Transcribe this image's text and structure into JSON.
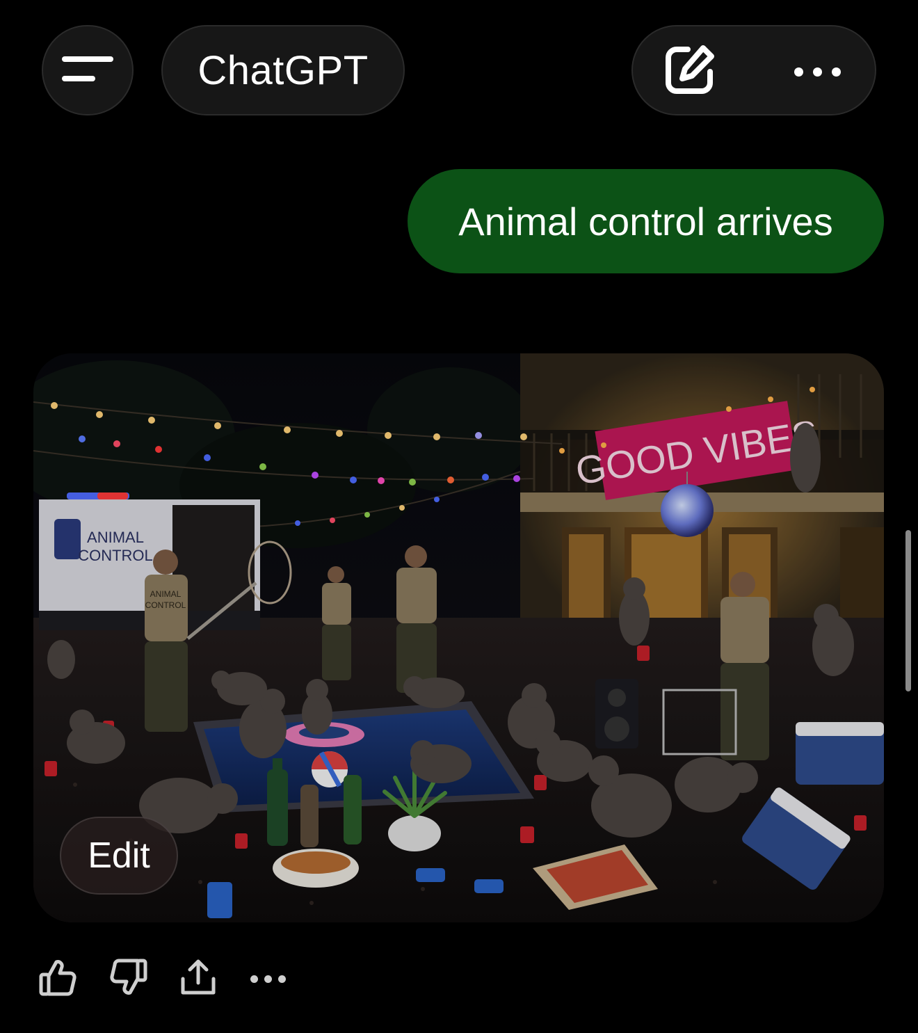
{
  "header": {
    "title": "ChatGPT",
    "menu_icon": "sidebar-menu-icon",
    "new_chat_icon": "new-chat-icon",
    "more_icon": "ellipsis-icon"
  },
  "conversation": {
    "user_message": "Animal control arrives",
    "assistant_image": {
      "truck_text": [
        "ANIMAL",
        "CONTROL"
      ],
      "banner_text": "GOOD VIBES",
      "uniform_text": [
        "ANIMAL",
        "CONTROL"
      ],
      "edit_label": "Edit"
    }
  },
  "message_actions": {
    "icons": [
      "thumbs-up-icon",
      "thumbs-down-icon",
      "share-icon",
      "ellipsis-icon"
    ]
  },
  "colors": {
    "background": "#000000",
    "pill_bg": "#171717",
    "user_bubble": "#0c5216",
    "banner": "#c2185b"
  }
}
